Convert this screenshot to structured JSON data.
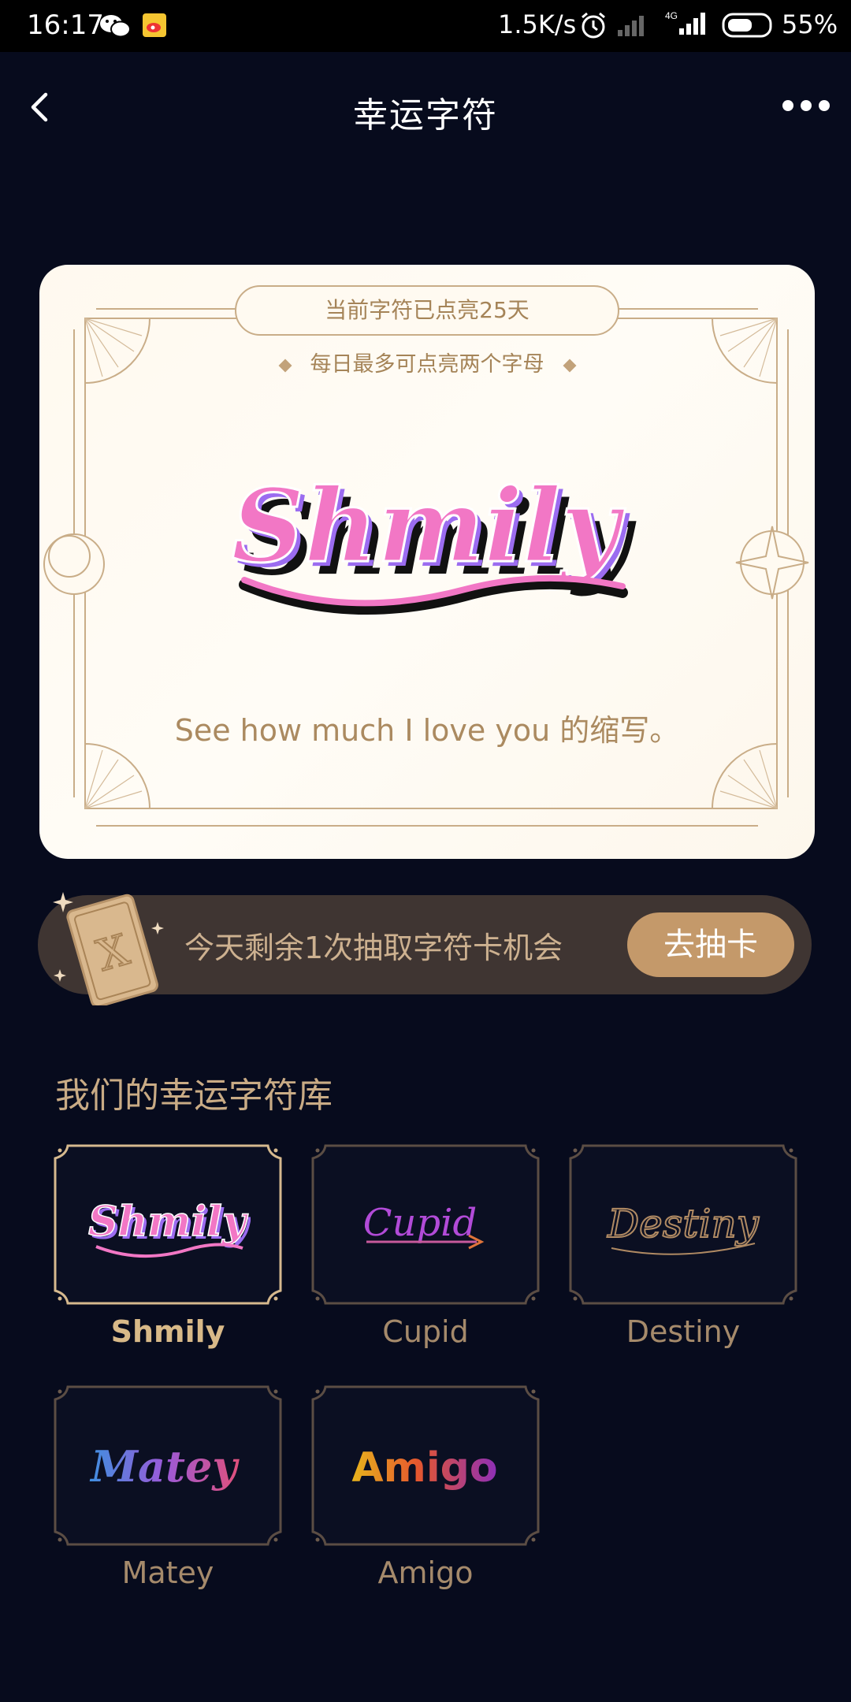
{
  "status_bar": {
    "time": "16:17",
    "network_speed": "1.5K/s",
    "network_type": "4G",
    "battery": "55%",
    "icons": [
      "wechat-icon",
      "weibo-icon",
      "alarm-icon",
      "signal-icon",
      "signal-4g-icon",
      "battery-icon"
    ]
  },
  "nav": {
    "title": "幸运字符",
    "back_icon": "chevron-left-icon",
    "more_icon": "more-dots-icon"
  },
  "hero_card": {
    "streak_text": "当前字符已点亮25天",
    "rule_text": "每日最多可点亮两个字母",
    "logo_text": "Shmily",
    "description": "See how much I love you 的缩写。"
  },
  "draw_banner": {
    "text": "今天剩余1次抽取字符卡机会",
    "button_label": "去抽卡",
    "card_letter": "X"
  },
  "library": {
    "title": "我们的幸运字符库",
    "items": [
      {
        "name": "Shmily",
        "logo_text": "Shmily",
        "selected": true
      },
      {
        "name": "Cupid",
        "logo_text": "Cupid",
        "selected": false
      },
      {
        "name": "Destiny",
        "logo_text": "Destiny",
        "selected": false
      },
      {
        "name": "Matey",
        "logo_text": "Matey",
        "selected": false
      },
      {
        "name": "Amigo",
        "logo_text": "Amigo",
        "selected": false
      }
    ]
  },
  "colors": {
    "background": "#070b1d",
    "gold": "#c4996a",
    "card_bg": "#fffaf1",
    "banner_bg": "#3f3532",
    "shmily_pink": "#f277c5",
    "shmily_purple": "#9b6cf0"
  }
}
